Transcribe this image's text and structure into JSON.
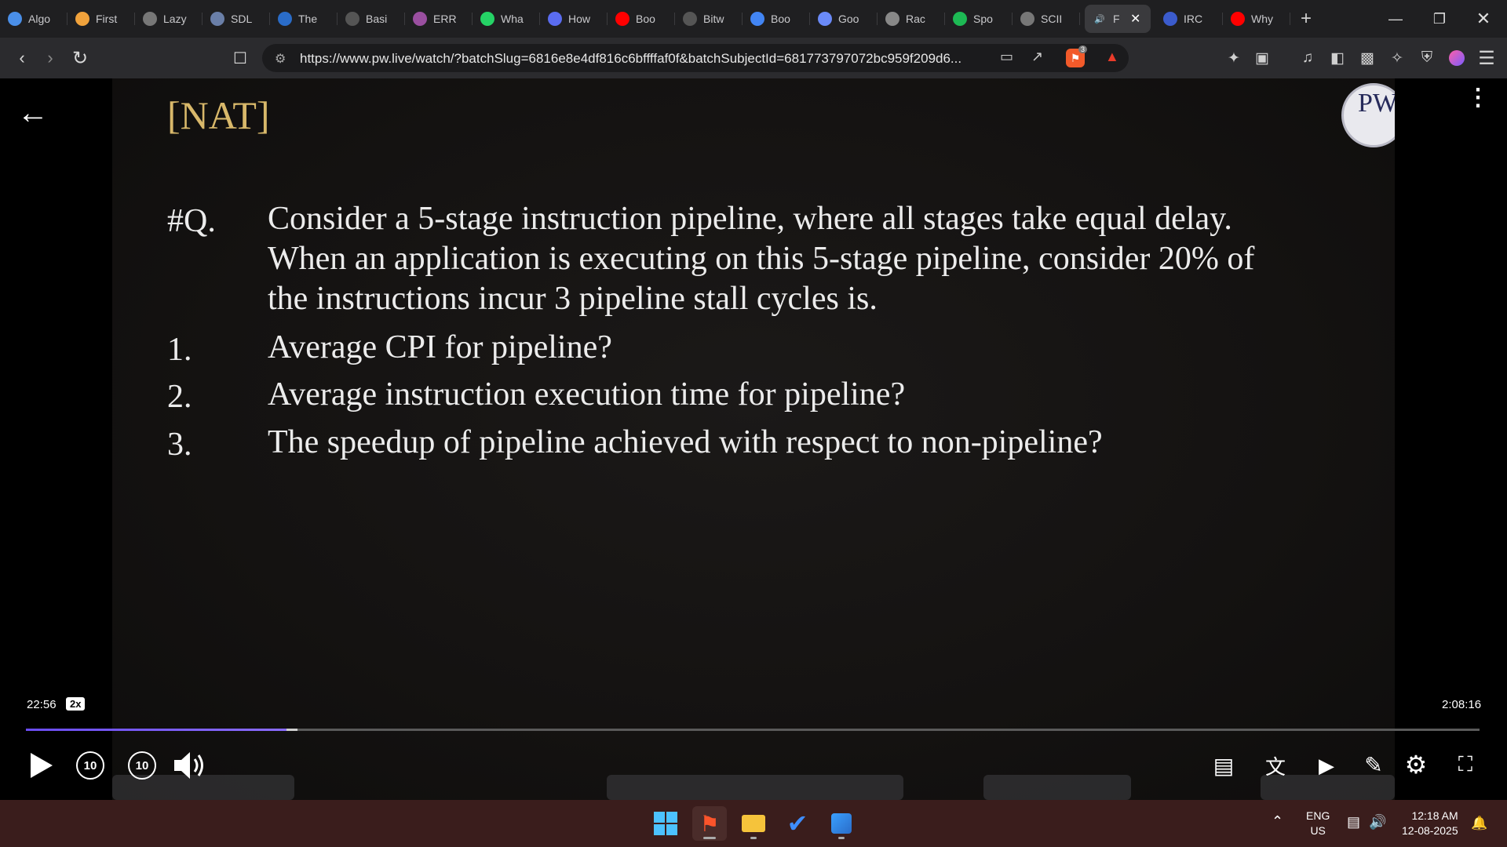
{
  "browser": {
    "tabs": [
      {
        "label": "Algo",
        "icon": "globe-icon",
        "color": "#4a8fe8"
      },
      {
        "label": "First",
        "icon": "bolt-icon",
        "color": "#f0a23c"
      },
      {
        "label": "Lazy",
        "icon": "globe-icon",
        "color": "#777777"
      },
      {
        "label": "SDL",
        "icon": "image-icon",
        "color": "#6a7fa8"
      },
      {
        "label": "The",
        "icon": "w3-icon",
        "color": "#2a6cc8"
      },
      {
        "label": "Basi",
        "icon": "page-icon",
        "color": "#555555"
      },
      {
        "label": "ERR",
        "icon": "brain-icon",
        "color": "#9a4fa0"
      },
      {
        "label": "Wha",
        "icon": "whatsapp-icon",
        "color": "#25d366"
      },
      {
        "label": "How",
        "icon": "bookmark-icon",
        "color": "#5a6cf0"
      },
      {
        "label": "Boo",
        "icon": "youtube-icon",
        "color": "#ff0000"
      },
      {
        "label": "Bitw",
        "icon": "code-icon",
        "color": "#555555"
      },
      {
        "label": "Boo",
        "icon": "google-icon",
        "color": "#4285f4"
      },
      {
        "label": "Goo",
        "icon": "gemini-icon",
        "color": "#6a8af8"
      },
      {
        "label": "Rac",
        "icon": "openai-icon",
        "color": "#888888"
      },
      {
        "label": "Spo",
        "icon": "spotify-icon",
        "color": "#1db954"
      },
      {
        "label": "SCII",
        "icon": "globe-icon",
        "color": "#777777"
      },
      {
        "label": "F",
        "icon": "speaker-icon",
        "color": "#3a3a3d",
        "active": true
      },
      {
        "label": "IRC",
        "icon": "image-icon",
        "color": "#3b5bcc"
      },
      {
        "label": "Why",
        "icon": "youtube-icon",
        "color": "#ff0000"
      }
    ],
    "new_tab_label": "+",
    "url": "https://www.pw.live/watch/?batchSlug=6816e8e4df816c6bffffaf0f&batchSubjectId=681773797072bc959f209d6...",
    "brave_badge": "3"
  },
  "slide": {
    "tag": "[NAT]",
    "logo_text": "PW",
    "question_label": "#Q.",
    "question_lines": [
      "Consider a 5-stage instruction pipeline, where all stages take equal delay.",
      "When an application is executing on this 5-stage pipeline, consider 20% of",
      "the instructions incur 3 pipeline stall cycles is."
    ],
    "items": [
      {
        "num": "1.",
        "text": "Average CPI for pipeline?"
      },
      {
        "num": "2.",
        "text": "Average instruction execution time for pipeline?"
      },
      {
        "num": "3.",
        "text": "The speedup of pipeline achieved with respect to non-pipeline?"
      }
    ]
  },
  "player": {
    "current_time": "22:56",
    "speed": "2x",
    "duration": "2:08:16",
    "played_fraction": 0.179,
    "rewind_label": "10",
    "forward_label": "10"
  },
  "taskbar": {
    "lang_top": "ENG",
    "lang_bottom": "US",
    "time": "12:18 AM",
    "date": "12-08-2025"
  }
}
